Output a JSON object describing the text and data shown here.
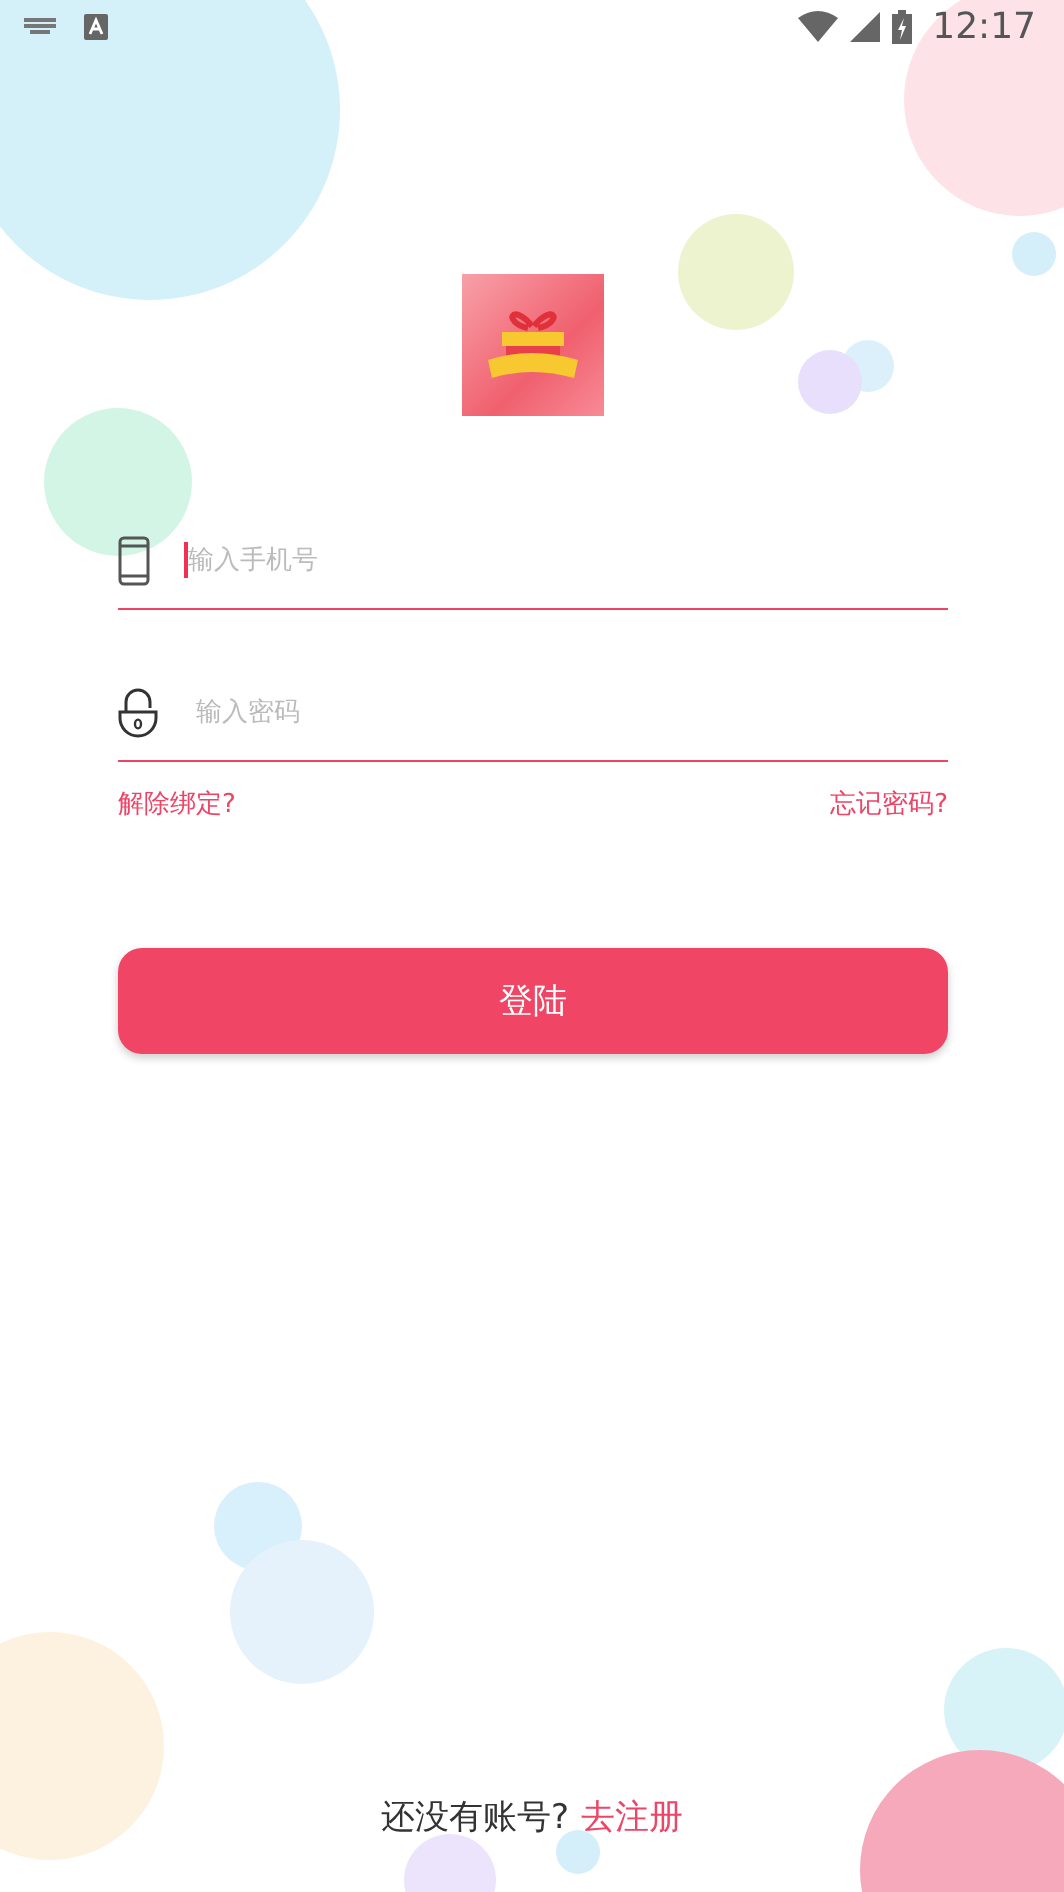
{
  "status_bar": {
    "time": "12:17"
  },
  "phone_field": {
    "placeholder": "输入手机号",
    "focused": true
  },
  "password_field": {
    "placeholder": "输入密码",
    "focused": false
  },
  "links": {
    "unbind": "解除绑定?",
    "forgot_password": "忘记密码?"
  },
  "login_button": {
    "label": "登陆"
  },
  "register": {
    "prompt": "还没有账号?",
    "link": "去注册"
  }
}
